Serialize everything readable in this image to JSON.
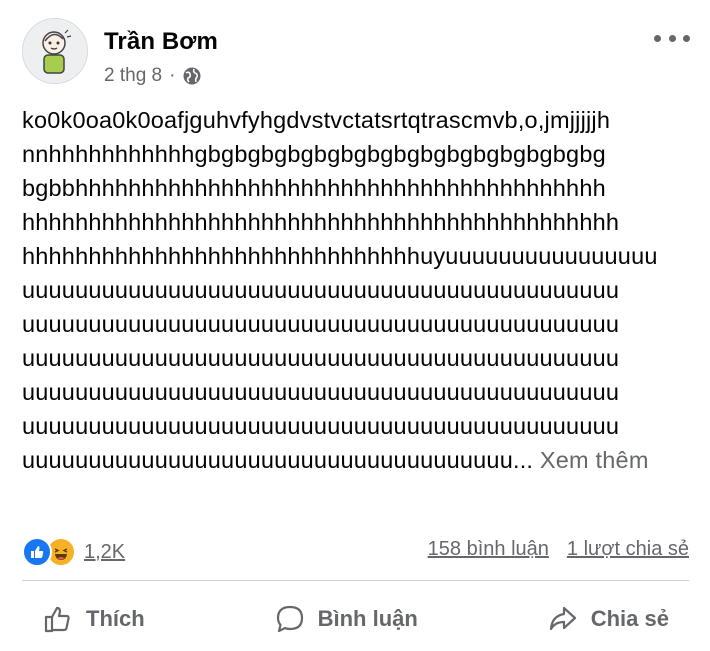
{
  "post": {
    "author": "Trần Bơm",
    "time": "2 thg 8",
    "separator": "·",
    "lines": [
      "ko0k0oa0k0oafjguhvfyhgdvstvctatsrtqtrascmvb,o,jmjjjjjh",
      "nnhhhhhhhhhhhgbgbgbgbgbgbgbgbgbgbgbgbgbgbgbg",
      "bgbbhhhhhhhhhhhhhhhhhhhhhhhhhhhhhhhhhhhhhhhh",
      "hhhhhhhhhhhhhhhhhhhhhhhhhhhhhhhhhhhhhhhhhhhhh",
      "hhhhhhhhhhhhhhhhhhhhhhhhhhhhhhuyuuuuuuuuuuuuuuuu",
      "uuuuuuuuuuuuuuuuuuuuuuuuuuuuuuuuuuuuuuuuuuuuu",
      "uuuuuuuuuuuuuuuuuuuuuuuuuuuuuuuuuuuuuuuuuuuuu",
      "uuuuuuuuuuuuuuuuuuuuuuuuuuuuuuuuuuuuuuuuuuuuu",
      "uuuuuuuuuuuuuuuuuuuuuuuuuuuuuuuuuuuuuuuuuuuuu",
      "uuuuuuuuuuuuuuuuuuuuuuuuuuuuuuuuuuuuuuuuuuuuu"
    ],
    "last_line": "uuuuuuuuuuuuuuuuuuuuuuuuuuuuuuuuuuuuu...",
    "see_more": "Xem thêm"
  },
  "stats": {
    "reaction_count": "1,2K",
    "comments": "158 bình luận",
    "shares": "1 lượt chia sẻ"
  },
  "actions": {
    "like": "Thích",
    "comment": "Bình luận",
    "share": "Chia sẻ"
  },
  "icons": {
    "more": "more-dots-icon",
    "privacy": "globe-icon",
    "like_reaction": "like-reaction-icon",
    "haha_reaction": "haha-reaction-icon",
    "like_action": "thumbs-up-icon",
    "comment_action": "comment-bubble-icon",
    "share_action": "share-arrow-icon"
  },
  "colors": {
    "text": "#050505",
    "secondary": "#65676b",
    "like_blue": "#1877f2",
    "haha_yellow": "#f7b125",
    "divider": "#ced0d4"
  }
}
